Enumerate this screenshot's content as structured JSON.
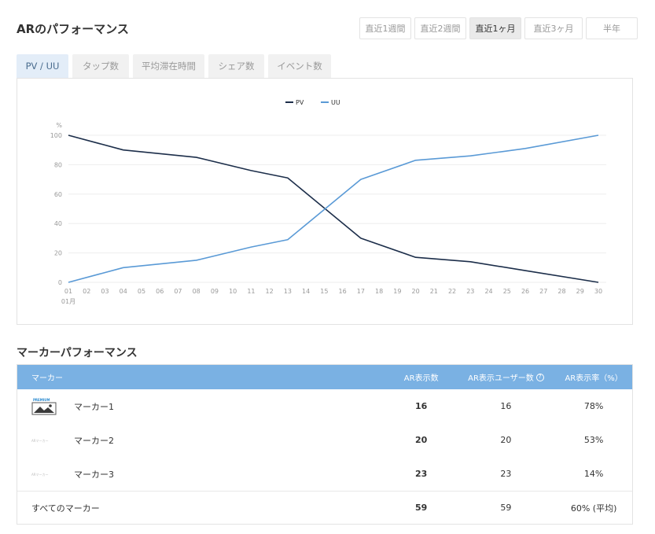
{
  "page": {
    "title": "ARのパフォーマンス"
  },
  "ranges": [
    {
      "label": "直近1週間",
      "active": false
    },
    {
      "label": "直近2週間",
      "active": false
    },
    {
      "label": "直近1ヶ月",
      "active": true
    },
    {
      "label": "直近3ヶ月",
      "active": false
    },
    {
      "label": "半年",
      "active": false
    }
  ],
  "tabs": [
    {
      "label": "PV / UU",
      "active": true
    },
    {
      "label": "タップ数",
      "active": false
    },
    {
      "label": "平均滞在時間",
      "active": false
    },
    {
      "label": "シェア数",
      "active": false
    },
    {
      "label": "イベント数",
      "active": false
    }
  ],
  "chart_data": {
    "type": "line",
    "ylabel": "%",
    "ylim": [
      0,
      100
    ],
    "yticks": [
      0,
      20,
      40,
      60,
      80,
      100
    ],
    "x": [
      "01",
      "02",
      "03",
      "04",
      "05",
      "06",
      "07",
      "08",
      "09",
      "10",
      "11",
      "12",
      "13",
      "14",
      "15",
      "16",
      "17",
      "18",
      "19",
      "20",
      "21",
      "22",
      "23",
      "24",
      "25",
      "26",
      "27",
      "28",
      "29",
      "30"
    ],
    "xsublabel": "01月",
    "series": [
      {
        "name": "PV",
        "color": "#1c2e4a",
        "points": [
          [
            "01",
            100
          ],
          [
            "04",
            90
          ],
          [
            "08",
            85
          ],
          [
            "11",
            76
          ],
          [
            "13",
            71
          ],
          [
            "17",
            30
          ],
          [
            "20",
            17
          ],
          [
            "23",
            14
          ],
          [
            "26",
            8
          ],
          [
            "30",
            0
          ]
        ]
      },
      {
        "name": "UU",
        "color": "#5a9ad6",
        "points": [
          [
            "01",
            0
          ],
          [
            "04",
            10
          ],
          [
            "08",
            15
          ],
          [
            "11",
            24
          ],
          [
            "13",
            29
          ],
          [
            "17",
            70
          ],
          [
            "20",
            83
          ],
          [
            "23",
            86
          ],
          [
            "26",
            91
          ],
          [
            "30",
            100
          ]
        ]
      }
    ],
    "legend": "top-center",
    "grid": true
  },
  "marker_section": {
    "title": "マーカーパフォーマンス"
  },
  "table": {
    "headers": {
      "marker": "マーカー",
      "count": "AR表示数",
      "users": "AR表示ユーザー数",
      "rate": "AR表示率（%）",
      "help_glyph": "?"
    },
    "rows": [
      {
        "name": "マーカー1",
        "count": "16",
        "users": "16",
        "rate": "78%",
        "thumb": "premium-image-icon",
        "thumb_text": "PREMIUM"
      },
      {
        "name": "マーカー2",
        "count": "20",
        "users": "20",
        "rate": "53%",
        "thumb": "placeholder-image",
        "thumb_text": "ARマーカー"
      },
      {
        "name": "マーカー3",
        "count": "23",
        "users": "23",
        "rate": "14%",
        "thumb": "placeholder-image",
        "thumb_text": "ARマーカー"
      }
    ],
    "total": {
      "name": "すべてのマーカー",
      "count": "59",
      "users": "59",
      "rate": "60% (平均)"
    }
  }
}
